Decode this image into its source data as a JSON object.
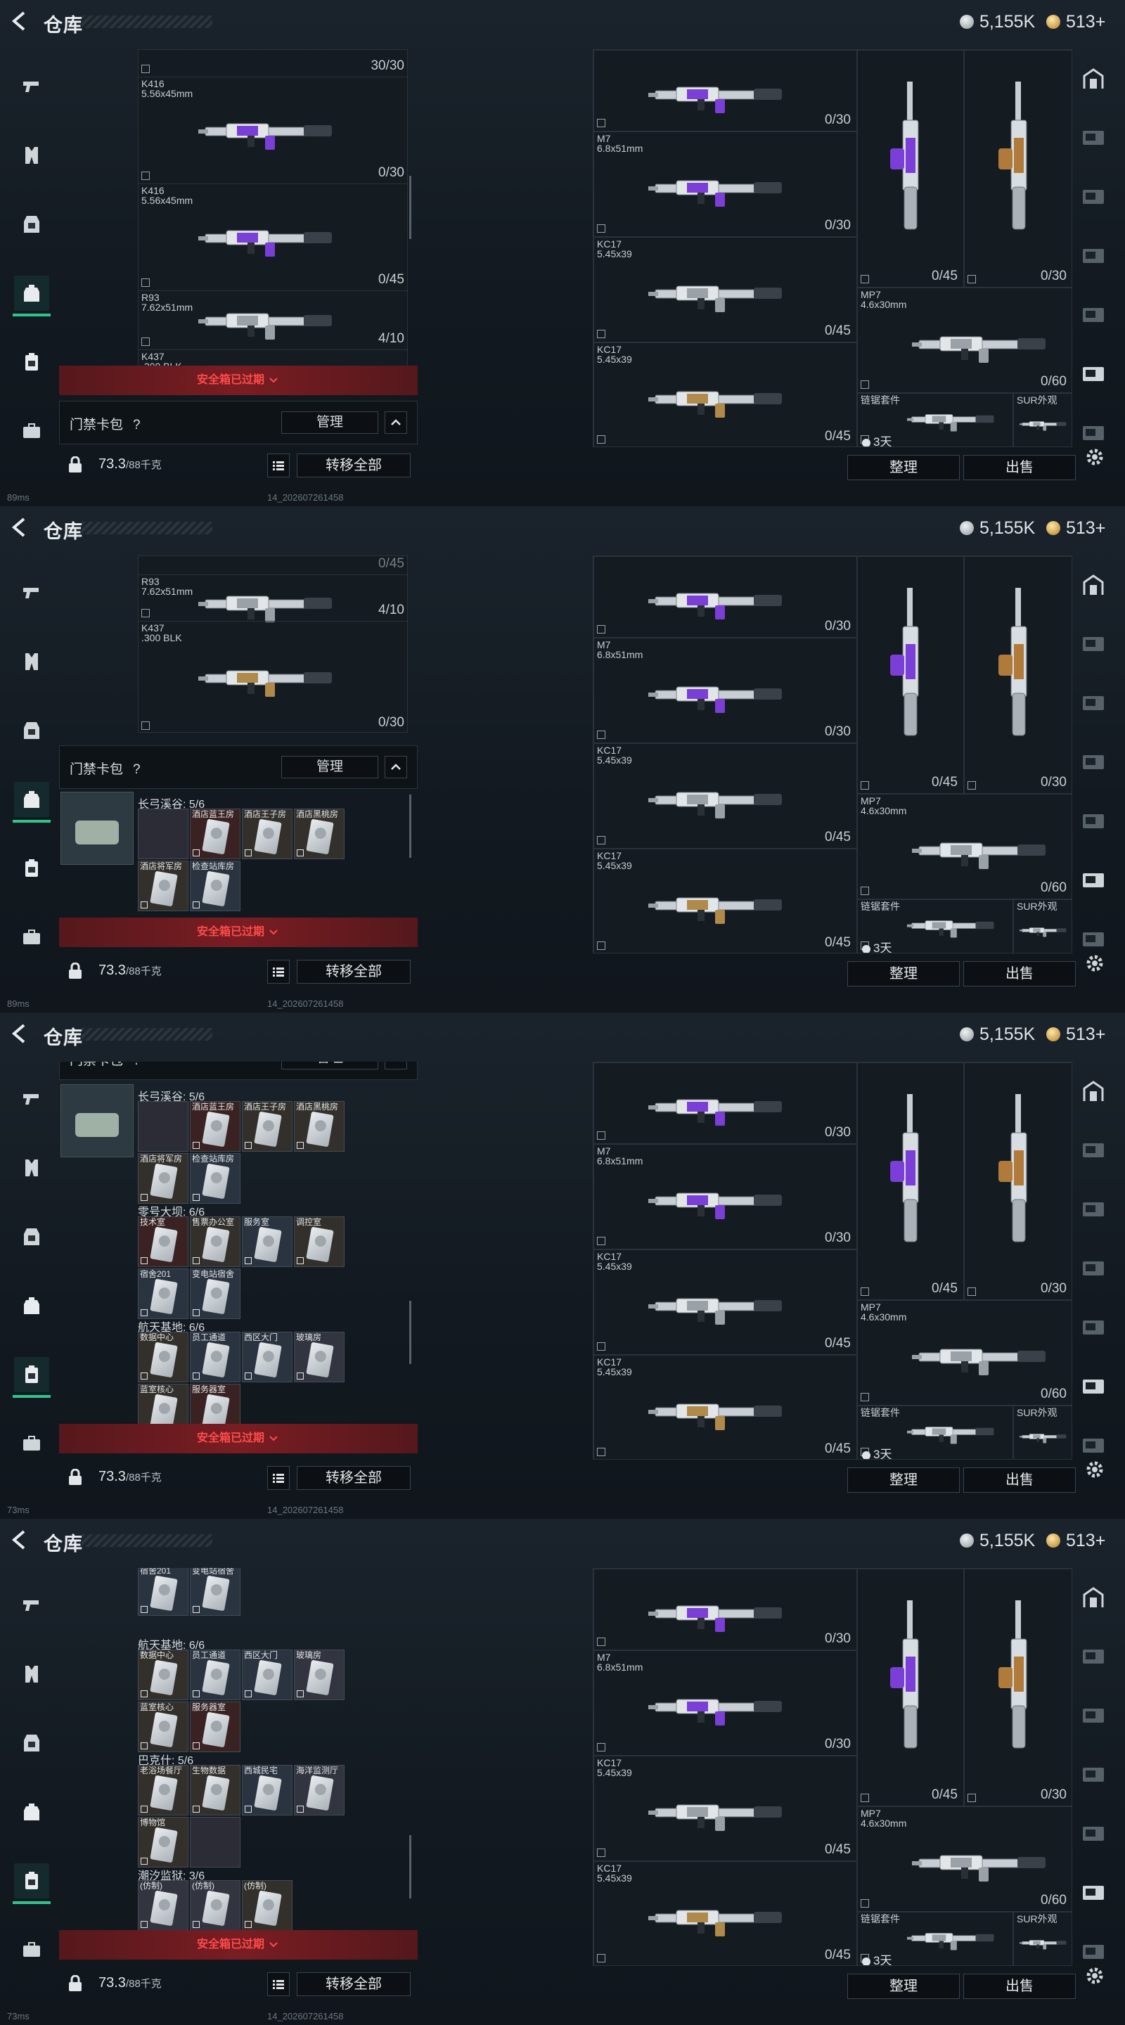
{
  "header": {
    "title": "仓库",
    "silver": "5,155K",
    "gold": "513+"
  },
  "sidebar": {
    "icons": [
      "pistol-icon",
      "armor-icon",
      "vest-icon",
      "backpack-icon",
      "keycard-case-icon",
      "case-icon"
    ]
  },
  "left": {
    "key_pack": {
      "title": "门禁卡包",
      "help": "?",
      "manage": "管理"
    },
    "warning": "安全箱已过期",
    "weight": "73.3",
    "weight_max": "/88千克",
    "transfer_all": "转移全部",
    "weapons": [
      {
        "name": "",
        "caliber": "",
        "count": "30/30"
      },
      {
        "name": "K416",
        "caliber": "5.56x45mm",
        "count": "0/30"
      },
      {
        "name": "K416",
        "caliber": "5.56x45mm",
        "count": "0/45"
      },
      {
        "name": "R93",
        "caliber": "7.62x51mm",
        "count": "4/10"
      },
      {
        "name": "K437",
        "caliber": ".300 BLK",
        "count": "0/30"
      }
    ],
    "frame2_top_count": "0/45",
    "regions": [
      {
        "name": "长弓溪谷: 5/6",
        "cards": [
          {
            "label": "",
            "style": "c5",
            "locked": false
          },
          {
            "label": "酒店蓝王房",
            "style": "c1",
            "locked": true
          },
          {
            "label": "酒店王子房",
            "style": "c2",
            "locked": true
          },
          {
            "label": "酒店黑桃房",
            "style": "c2",
            "locked": true
          },
          {
            "label": "酒店将军房",
            "style": "c2",
            "locked": true
          },
          {
            "label": "检查站库房",
            "style": "c3",
            "locked": true
          }
        ]
      },
      {
        "name": "零号大坝: 6/6",
        "cards": [
          {
            "label": "技术室",
            "style": "c1",
            "locked": true
          },
          {
            "label": "售票办公室",
            "style": "c2",
            "locked": true
          },
          {
            "label": "服务室",
            "style": "c3",
            "locked": true
          },
          {
            "label": "调控室",
            "style": "c2",
            "locked": true
          },
          {
            "label": "宿舍201",
            "style": "c3",
            "locked": true
          },
          {
            "label": "变电站宿舍",
            "style": "c3",
            "locked": true
          }
        ]
      },
      {
        "name": "航天基地: 6/6",
        "cards": [
          {
            "label": "数据中心",
            "style": "c2",
            "locked": true
          },
          {
            "label": "员工通道",
            "style": "c3",
            "locked": true
          },
          {
            "label": "西区大门",
            "style": "c3",
            "locked": true
          },
          {
            "label": "玻璃房",
            "style": "c4",
            "locked": true
          },
          {
            "label": "蓝室核心",
            "style": "c2",
            "locked": true
          },
          {
            "label": "服务器室",
            "style": "c1",
            "locked": true
          }
        ]
      },
      {
        "name": "巴克什: 5/6",
        "cards": [
          {
            "label": "老浴场餐厅",
            "style": "c2",
            "locked": true
          },
          {
            "label": "生物数据",
            "style": "c2",
            "locked": true
          },
          {
            "label": "西城民宅",
            "style": "c3",
            "locked": true
          },
          {
            "label": "海洋监测厅",
            "style": "c4",
            "locked": true
          },
          {
            "label": "博物馆",
            "style": "c2",
            "locked": true
          },
          {
            "label": "",
            "style": "c5",
            "locked": false
          }
        ]
      },
      {
        "name": "潮汐监狱: 3/6",
        "cards": [
          {
            "label": "(仿制)",
            "style": "c4",
            "locked": true
          },
          {
            "label": "(仿制)",
            "style": "c4",
            "locked": true
          },
          {
            "label": "(仿制)",
            "style": "c2",
            "locked": true
          }
        ]
      }
    ]
  },
  "right": {
    "slots": [
      {
        "name": "",
        "caliber": "",
        "count": "0/30"
      },
      {
        "name": "M7",
        "caliber": "6.8x51mm",
        "count": "0/30"
      },
      {
        "name": "KC17",
        "caliber": "5.45x39",
        "count": "0/45"
      },
      {
        "name": "KC17",
        "caliber": "5.45x39",
        "count": "0/45"
      },
      {
        "name": "",
        "caliber": "",
        "count": "0/45"
      },
      {
        "name": "",
        "caliber": "",
        "count": "0/30"
      },
      {
        "name": "MP7",
        "caliber": "4.6x30mm",
        "count": "0/60"
      },
      {
        "name": "链锯套件",
        "caliber": "",
        "count": "3天"
      },
      {
        "name": "SUR外观",
        "caliber": "",
        "count": ""
      }
    ],
    "tidy": "整理",
    "sell": "出售"
  },
  "status": [
    {
      "ping": "89ms",
      "ts": "14_202607261458"
    },
    {
      "ping": "89ms",
      "ts": "14_202607261458"
    },
    {
      "ping": "73ms",
      "ts": "14_202607261458"
    },
    {
      "ping": "73ms",
      "ts": "14_202607261458"
    }
  ],
  "colors": {
    "accent": "#2fc58a",
    "warning": "#ff4b4b",
    "weapon_purple": "#7b3ed6"
  }
}
